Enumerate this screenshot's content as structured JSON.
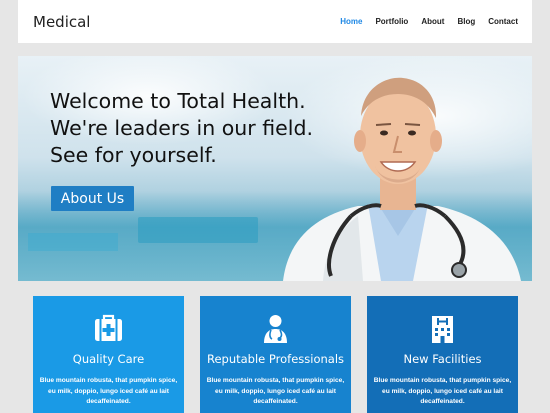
{
  "nav": {
    "brand": "Medical",
    "items": [
      {
        "label": "Home"
      },
      {
        "label": "Portfolio"
      },
      {
        "label": "About"
      },
      {
        "label": "Blog"
      },
      {
        "label": "Contact"
      }
    ],
    "active": "Home",
    "accent_color": "#1e88e5"
  },
  "hero": {
    "lines": [
      "Welcome to Total Health.",
      "We're leaders in our field.",
      "See for yourself."
    ],
    "button_label": "About Us",
    "button_color": "#1f7ec4",
    "image": "doctor-with-stethoscope"
  },
  "features": [
    {
      "icon": "first-aid-kit-icon",
      "title": "Quality Care",
      "text": "Blue mountain robusta, that pumpkin spice, eu milk, doppio, lungo iced café au lait decaffeinated.",
      "color": "#1a9ae6"
    },
    {
      "icon": "doctor-icon",
      "title": "Reputable Professionals",
      "text": "Blue mountain robusta, that pumpkin spice, eu milk, doppio, lungo iced café au lait decaffeinated.",
      "color": "#1783cf"
    },
    {
      "icon": "hospital-building-icon",
      "title": "New Facilities",
      "text": "Blue mountain robusta, that pumpkin spice, eu milk, doppio, lungo iced café au lait decaffeinated.",
      "color": "#136eb7"
    }
  ]
}
